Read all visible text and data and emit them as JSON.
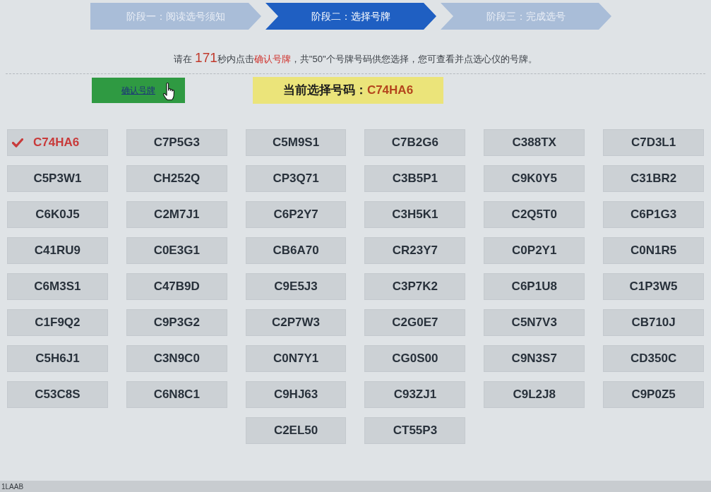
{
  "steps": [
    {
      "label": "阶段一：阅读选号须知",
      "selected": false
    },
    {
      "label": "阶段二：选择号牌",
      "selected": true
    },
    {
      "label": "阶段三：完成选号",
      "selected": false
    }
  ],
  "instruction": [
    {
      "text": "请在 ",
      "kind": "plain"
    },
    {
      "text": "171",
      "kind": "timer"
    },
    {
      "text": "秒内点击",
      "kind": "plain"
    },
    {
      "text": "确认号牌",
      "kind": "action"
    },
    {
      "text": "，共\"50\"个号牌号码供您选择，您可查看并点选心仪的号牌。",
      "kind": "plain"
    }
  ],
  "confirm_button": {
    "label": "确认号牌"
  },
  "current_selection": {
    "label": "当前选择号码：",
    "value": "C74HA6"
  },
  "plates": [
    {
      "number": "C74HA6",
      "selected": true
    },
    {
      "number": "C7P5G3",
      "selected": false
    },
    {
      "number": "C5M9S1",
      "selected": false
    },
    {
      "number": "C7B2G6",
      "selected": false
    },
    {
      "number": "C388TX",
      "selected": false
    },
    {
      "number": "C7D3L1",
      "selected": false
    },
    {
      "number": "C5P3W1",
      "selected": false
    },
    {
      "number": "CH252Q",
      "selected": false
    },
    {
      "number": "CP3Q71",
      "selected": false
    },
    {
      "number": "C3B5P1",
      "selected": false
    },
    {
      "number": "C9K0Y5",
      "selected": false
    },
    {
      "number": "C31BR2",
      "selected": false
    },
    {
      "number": "C6K0J5",
      "selected": false
    },
    {
      "number": "C2M7J1",
      "selected": false
    },
    {
      "number": "C6P2Y7",
      "selected": false
    },
    {
      "number": "C3H5K1",
      "selected": false
    },
    {
      "number": "C2Q5T0",
      "selected": false
    },
    {
      "number": "C6P1G3",
      "selected": false
    },
    {
      "number": "C41RU9",
      "selected": false
    },
    {
      "number": "C0E3G1",
      "selected": false
    },
    {
      "number": "CB6A70",
      "selected": false
    },
    {
      "number": "CR23Y7",
      "selected": false
    },
    {
      "number": "C0P2Y1",
      "selected": false
    },
    {
      "number": "C0N1R5",
      "selected": false
    },
    {
      "number": "C6M3S1",
      "selected": false
    },
    {
      "number": "C47B9D",
      "selected": false
    },
    {
      "number": "C9E5J3",
      "selected": false
    },
    {
      "number": "C3P7K2",
      "selected": false
    },
    {
      "number": "C6P1U8",
      "selected": false
    },
    {
      "number": "C1P3W5",
      "selected": false
    },
    {
      "number": "C1F9Q2",
      "selected": false
    },
    {
      "number": "C9P3G2",
      "selected": false
    },
    {
      "number": "C2P7W3",
      "selected": false
    },
    {
      "number": "C2G0E7",
      "selected": false
    },
    {
      "number": "C5N7V3",
      "selected": false
    },
    {
      "number": "CB710J",
      "selected": false
    },
    {
      "number": "C5H6J1",
      "selected": false
    },
    {
      "number": "C3N9C0",
      "selected": false
    },
    {
      "number": "C0N7Y1",
      "selected": false
    },
    {
      "number": "CG0S00",
      "selected": false
    },
    {
      "number": "C9N3S7",
      "selected": false
    },
    {
      "number": "CD350C",
      "selected": false
    },
    {
      "number": "C53C8S",
      "selected": false
    },
    {
      "number": "C6N8C1",
      "selected": false
    },
    {
      "number": "C9HJ63",
      "selected": false
    },
    {
      "number": "C93ZJ1",
      "selected": false
    },
    {
      "number": "C9L2J8",
      "selected": false
    },
    {
      "number": "C9P0Z5",
      "selected": false
    },
    {
      "number": "C2EL50",
      "selected": false
    },
    {
      "number": "CT55P3",
      "selected": false
    }
  ],
  "status_bar": {
    "text": "1LAAB"
  }
}
